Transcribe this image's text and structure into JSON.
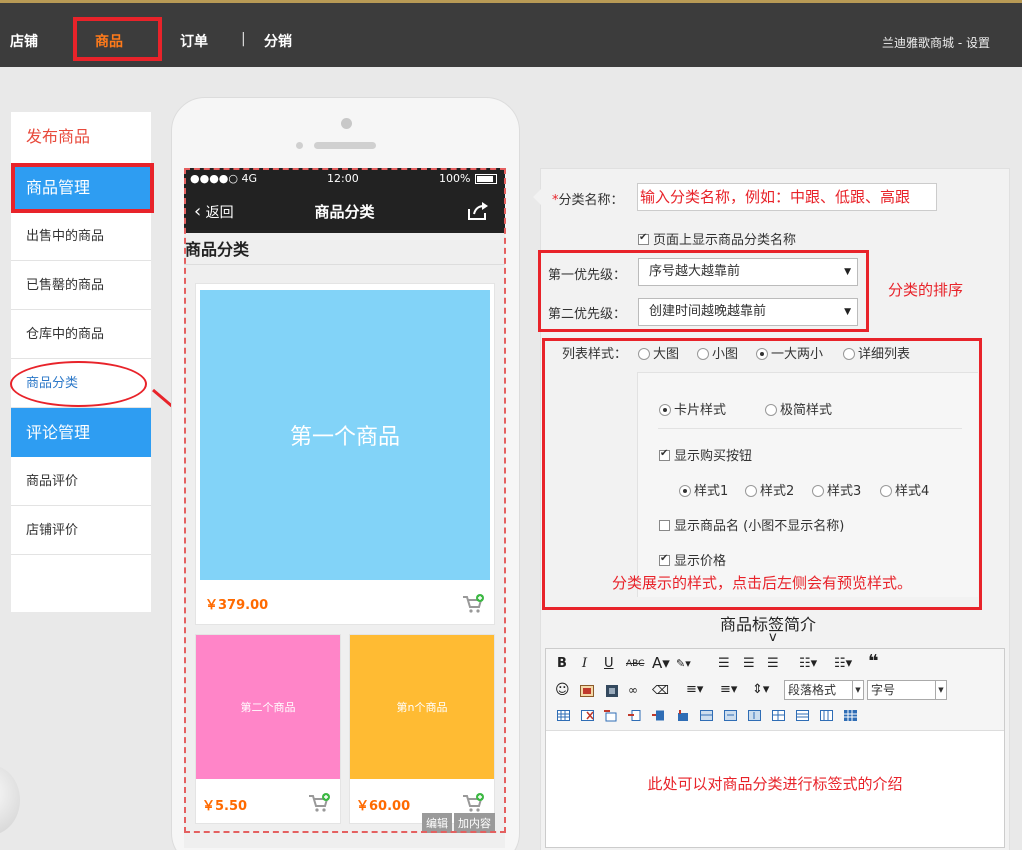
{
  "topnav": {
    "items": [
      "店铺",
      "商品",
      "订单",
      "分销"
    ],
    "separator": "|",
    "right_text": "兰迪雅歌商城 - 设置",
    "accent": "#ff7a1a"
  },
  "sidebar": {
    "publish": "发布商品",
    "section1": "商品管理",
    "items1": [
      "出售中的商品",
      "已售罄的商品",
      "仓库中的商品",
      "商品分类"
    ],
    "section2": "评论管理",
    "items2": [
      "商品评价",
      "店铺评价"
    ],
    "accent": "#2e9df2"
  },
  "phone": {
    "status": {
      "signal": "●●●●○ 4G",
      "time": "12:00",
      "battery": "100%"
    },
    "back_label": "返回",
    "title": "商品分类",
    "page_title": "商品分类",
    "products": [
      {
        "name": "第一个商品",
        "price": "￥379.00",
        "color": "#82d3f8"
      },
      {
        "name": "第二个商品",
        "price": "￥5.50",
        "color": "#ff85c8"
      },
      {
        "name": "第n个商品",
        "price": "￥60.00",
        "color": "#ffbb33"
      }
    ],
    "edit_btn": "编辑",
    "add_btn": "加内容"
  },
  "form": {
    "name_label": "分类名称：",
    "required_mark": "*",
    "name_input": "输入分类名称，例如：中跟、低跟、高跟",
    "show_name_label": "页面上显示商品分类名称",
    "prio1_label": "第一优先级：",
    "prio1_value": "序号越大越靠前",
    "prio2_label": "第二优先级：",
    "prio2_value": "创建时间越晚越靠前",
    "sort_note": "分类的排序",
    "list_style_label": "列表样式：",
    "list_styles": [
      "大图",
      "小图",
      "一大两小",
      "详细列表"
    ],
    "card_styles": [
      "卡片样式",
      "极简样式"
    ],
    "show_buy": "显示购买按钮",
    "buy_styles": [
      "样式1",
      "样式2",
      "样式3",
      "样式4"
    ],
    "show_product_name": "显示商品名 (小图不显示名称)",
    "show_price": "显示价格",
    "style_note": "分类展示的样式，点击后左侧会有预览样式。",
    "tag_title": "商品标签简介",
    "tag_caret": "v",
    "editor_para": "段落格式",
    "editor_size": "字号",
    "editor_note": "此处可以对商品分类进行标签式的介绍"
  }
}
